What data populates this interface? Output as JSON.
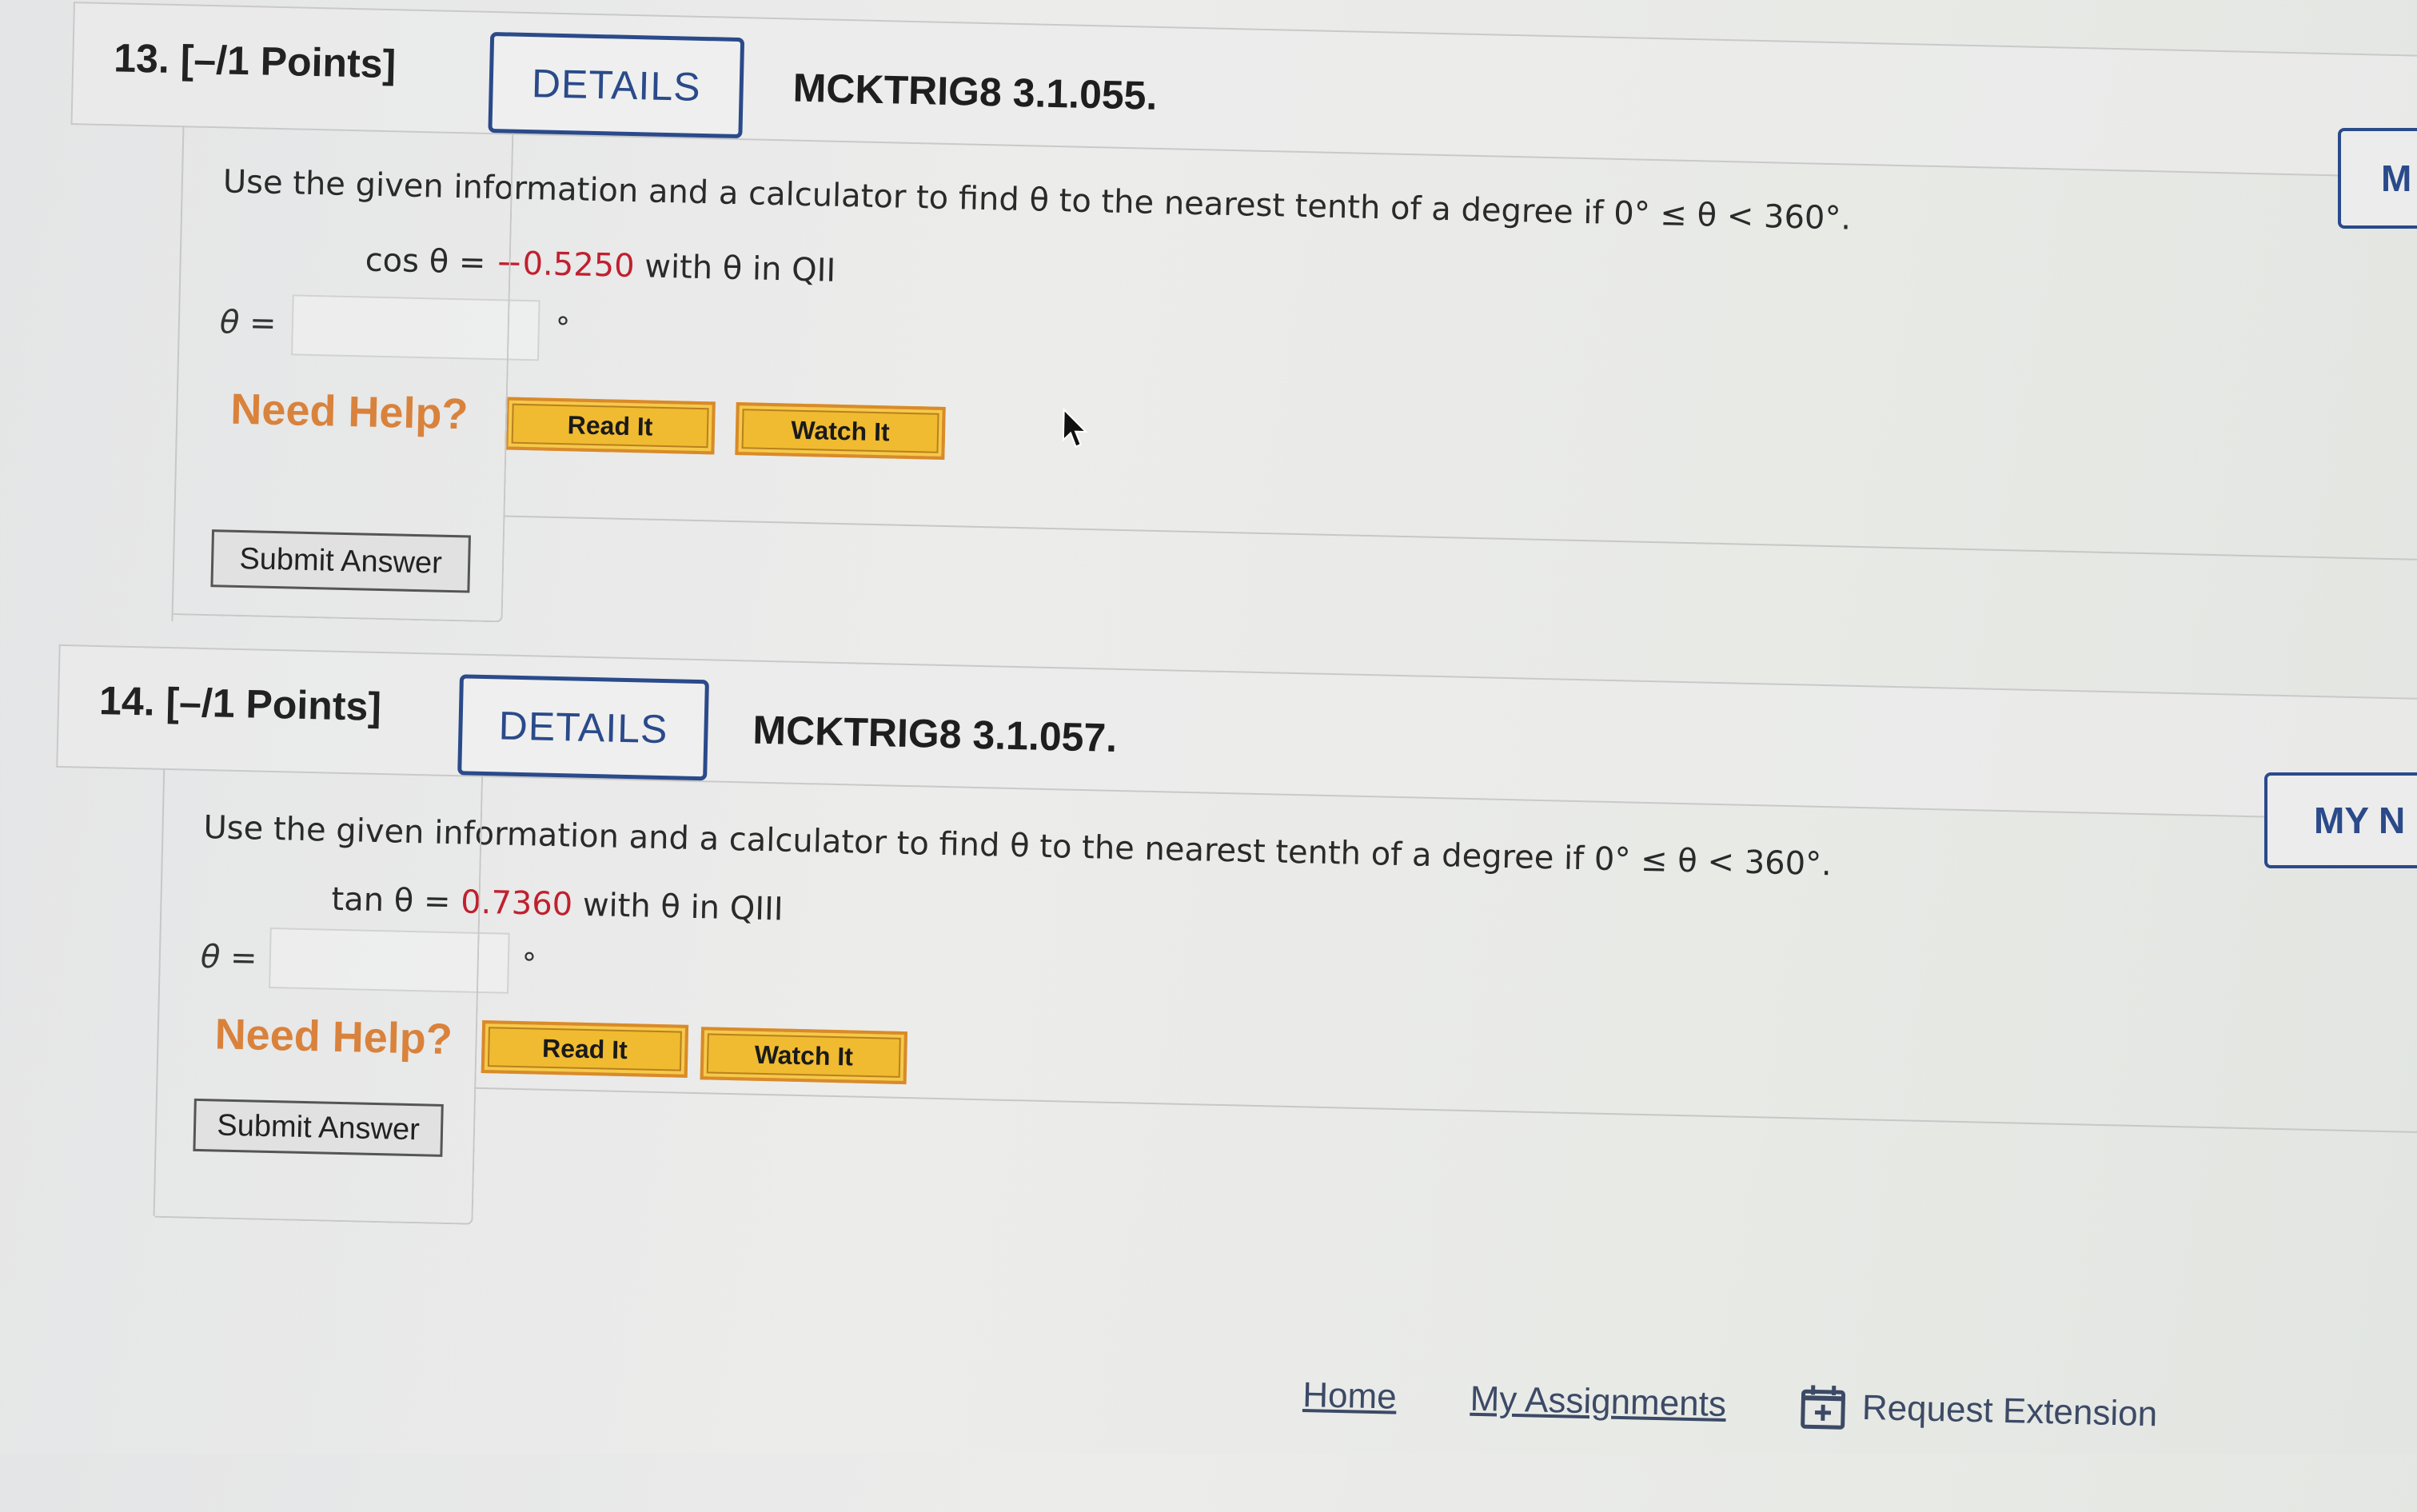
{
  "questions": [
    {
      "number_label": "13.  [–/1 Points]",
      "details_label": "DETAILS",
      "code": "MCKTRIG8 3.1.055.",
      "prompt": "Use the given information and a calculator to find θ to the nearest tenth of a degree if 0° ≤ θ < 360°.",
      "given_func": "cos θ = ",
      "given_value": "−0.5250",
      "given_suffix": " with θ in QII",
      "answer_label": "θ =",
      "answer_value": "",
      "answer_unit": "°",
      "need_help_label": "Need Help?",
      "read_it_label": "Read It",
      "watch_it_label": "Watch It",
      "submit_label": "Submit Answer"
    },
    {
      "number_label": "14.  [–/1 Points]",
      "details_label": "DETAILS",
      "code": "MCKTRIG8 3.1.057.",
      "prompt": "Use the given information and a calculator to find θ to the nearest tenth of a degree if 0° ≤ θ < 360°.",
      "given_func": "tan θ = ",
      "given_value": "0.7360",
      "given_suffix": " with θ in QIII",
      "answer_label": "θ =",
      "answer_value": "",
      "answer_unit": "°",
      "need_help_label": "Need Help?",
      "read_it_label": "Read It",
      "watch_it_label": "Watch It",
      "submit_label": "Submit Answer"
    }
  ],
  "side_tabs": [
    "M",
    "MY N"
  ],
  "footer": {
    "home": "Home",
    "my_assignments": "My Assignments",
    "request_extension": "Request Extension"
  },
  "colors": {
    "accent_blue": "#2a4a8a",
    "given_red": "#c0202e",
    "help_orange": "#d9823c",
    "help_button_yellow": "#f0bb30"
  }
}
